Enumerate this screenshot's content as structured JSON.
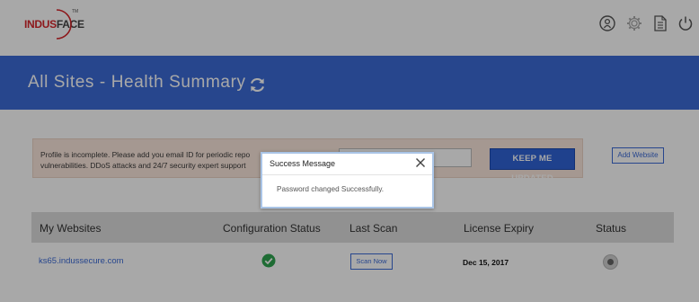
{
  "brand": {
    "logo_red": "INDUS",
    "logo_dark": "FACE",
    "trademark": "TM",
    "red": "#d6262b",
    "dark": "#444444"
  },
  "topbar": {
    "icons": [
      "user-icon",
      "gear-icon",
      "document-icon",
      "power-icon"
    ]
  },
  "header": {
    "title": "All Sites - Health Summary",
    "background": "#3c6bd7",
    "refresh_icon": "refresh-icon"
  },
  "notice": {
    "line1": "Profile is incomplete. Please add you email ID for periodic repo",
    "line2": "vulnerabilities. DDoS attacks and 24/7 security expert support",
    "email_value": "",
    "button_label": "KEEP ME UPDATED",
    "background": "#fbe7dc"
  },
  "add_website_label": "Add Website",
  "table": {
    "headers": [
      "My Websites",
      "Configuration Status",
      "Last Scan",
      "License Expiry",
      "Status"
    ],
    "rows": [
      {
        "website": "ks65.indussecure.com",
        "configuration_status": "check-circle-icon",
        "last_scan_button": "Scan Now",
        "license_expiry": "Dec 15, 2017",
        "status": "status-indicator"
      }
    ]
  },
  "modal": {
    "title": "Success Message",
    "message": "Password changed Successfully.",
    "close_icon": "close-icon"
  }
}
